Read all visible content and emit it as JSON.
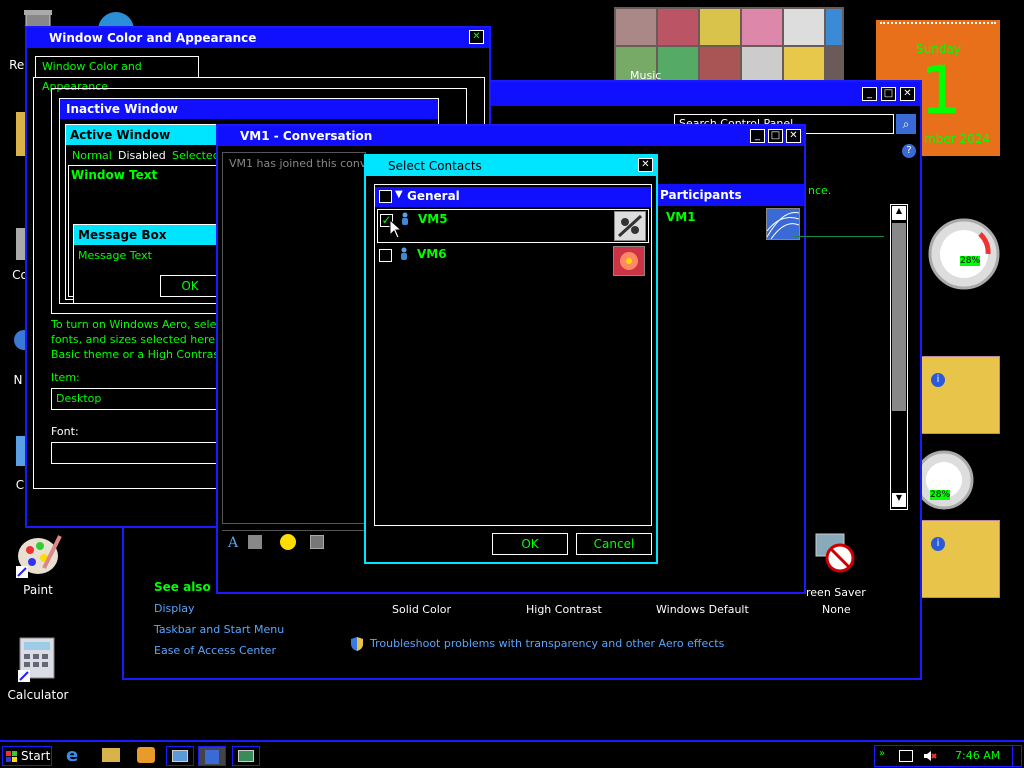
{
  "desktop": {
    "icons": [
      {
        "label": "Rec",
        "name": "recycle-bin"
      },
      {
        "label": "Co",
        "name": "computer"
      },
      {
        "label": "N",
        "name": "network"
      },
      {
        "label": "C",
        "name": "control-panel"
      },
      {
        "label": "Paint",
        "name": "paint"
      },
      {
        "label": "Calculator",
        "name": "calculator"
      }
    ]
  },
  "calendar_gadget": {
    "day_name": "Sunday",
    "day": "1",
    "month_year": "mber 2024"
  },
  "media_gadget": {
    "label": "Music"
  },
  "gauge_gadget": {
    "percent_top": "28%",
    "percent_bottom": "28%"
  },
  "control_panel": {
    "search_placeholder": "Search Control Panel",
    "line_text": "nce.",
    "see_also": "See also",
    "links": [
      "Display",
      "Taskbar and Start Menu",
      "Ease of Access Center"
    ],
    "themes": [
      "Solid Color",
      "High Contrast",
      "Windows Default",
      "None"
    ],
    "screen_saver": "reen Saver",
    "troubleshoot": "Troubleshoot problems with transparency and other Aero effects"
  },
  "appearance_dialog": {
    "title": "Window Color and Appearance",
    "tab": "Window Color and Appearance",
    "inactive_window": "Inactive Window",
    "active_window": "Active Window",
    "menu_normal": "Normal",
    "menu_disabled": "Disabled",
    "menu_selected": "Selected",
    "window_text": "Window Text",
    "message_box": "Message Box",
    "message_text": "Message Text",
    "ok": "OK",
    "info_text": [
      "To turn on Windows Aero, selec",
      "fonts, and sizes selected here ap",
      "Basic theme or a High Contrast"
    ],
    "item_label": "Item:",
    "item_value": "Desktop",
    "font_label": "Font:"
  },
  "conversation": {
    "title": "VM1 - Conversation",
    "joined": "VM1 has joined this convers",
    "participants_header": "Participants",
    "participant": "VM1"
  },
  "select_contacts": {
    "title": "Select Contacts",
    "group": "General",
    "contacts": [
      {
        "name": "VM5",
        "checked": true
      },
      {
        "name": "VM6",
        "checked": false
      }
    ],
    "ok": "OK",
    "cancel": "Cancel"
  },
  "taskbar": {
    "start": "Start",
    "time": "7:46 AM"
  },
  "colors": {
    "accent": "#1010ff",
    "highlight": "#00e5ff",
    "text": "#00ff00"
  }
}
